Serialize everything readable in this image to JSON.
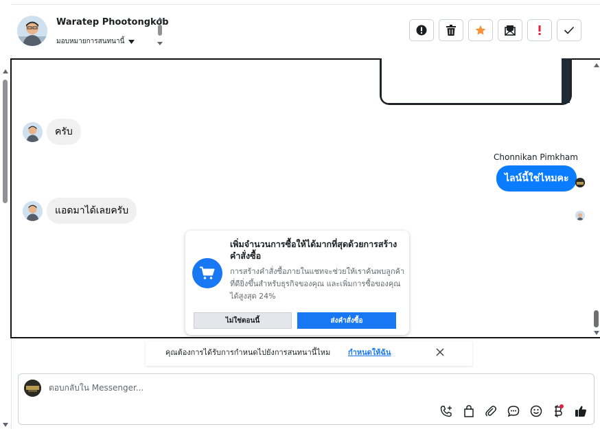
{
  "header": {
    "contact_name": "Waratep Phootongkob",
    "assign_label": "มอบหมายการสนทนานี้",
    "toolbar": [
      {
        "name": "spam-button",
        "icon": "exclamation-circle-icon"
      },
      {
        "name": "delete-button",
        "icon": "trash-icon"
      },
      {
        "name": "star-button",
        "icon": "star-icon"
      },
      {
        "name": "mark-unread-button",
        "icon": "envelope-icon"
      },
      {
        "name": "follow-up-button",
        "icon": "exclamation-icon"
      },
      {
        "name": "done-button",
        "icon": "check-icon"
      }
    ]
  },
  "messages": [
    {
      "direction": "in",
      "text": "ครับ"
    },
    {
      "direction": "out",
      "sender": "Chonnikan Pimkham",
      "text": "ไลน์นี้ใช่ไหมคะ"
    },
    {
      "direction": "in",
      "text": "แอดมาได้เลยครับ"
    }
  ],
  "promo": {
    "title": "เพิ่มจำนวนการซื้อให้ได้มากที่สุดด้วยการสร้างคำสั่งซื้อ",
    "body": "การสร้างคำสั่งซื้อภายในแชทจะช่วยให้เราค้นพบลูกค้าที่ดียิ่งขึ้นสำหรับธุรกิจของคุณ และเพิ่มการซื้อของคุณได้สูงสุด 24%",
    "not_now": "ไม่ใช่ตอนนี้",
    "send_order": "ส่งคำสั่งซื้อ"
  },
  "notice": {
    "text": "คุณต้องการได้รับการกำหนดไปยังการสนทนานี้ไหม",
    "link": "กำหนดให้ฉัน"
  },
  "composer": {
    "placeholder": "ตอบกลับใน Messenger...",
    "tools": [
      "phone-plus-icon",
      "shopping-bag-icon",
      "paperclip-icon",
      "chat-bubble-icon",
      "smiley-icon",
      "baht-icon",
      "thumbs-up-icon"
    ]
  },
  "colors": {
    "brand": "#1877f2",
    "outgoing_bubble": "#0a7cff",
    "incoming_bubble": "#f0f0f0",
    "star": "#f7923a",
    "alert": "#e41e3f"
  }
}
